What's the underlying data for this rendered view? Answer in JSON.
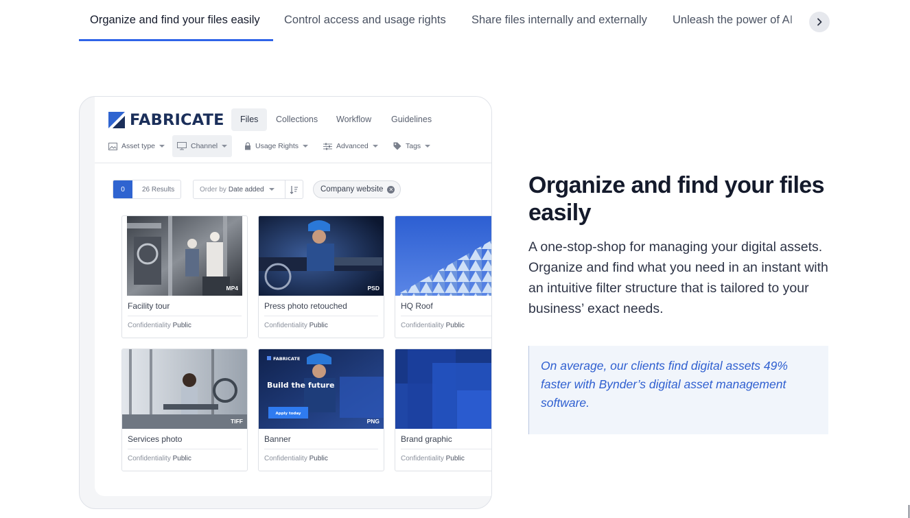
{
  "tabs": {
    "items": [
      {
        "label": "Organize and find your files easily",
        "active": true
      },
      {
        "label": "Control access and usage rights",
        "active": false
      },
      {
        "label": "Share files internally and externally",
        "active": false
      },
      {
        "label": "Unleash the power of AI",
        "active": false
      }
    ],
    "next_icon": "chevron-right-icon",
    "accent_color": "#2f64e8"
  },
  "mock": {
    "logo_text": "FABRICATE",
    "nav": [
      "Files",
      "Collections",
      "Workflow",
      "Guidelines"
    ],
    "filters": [
      {
        "label": "Asset type",
        "icon": "image-icon"
      },
      {
        "label": "Channel",
        "icon": "monitor-icon"
      },
      {
        "label": "Usage Rights",
        "icon": "lock-icon"
      },
      {
        "label": "Advanced",
        "icon": "sliders-icon"
      },
      {
        "label": "Tags",
        "icon": "tag-icon"
      }
    ],
    "selected_count": "0",
    "results_label": "26 Results",
    "order_prefix": "Order by",
    "order_value": "Date added",
    "active_chip": "Company website",
    "meta_label": "Confidentiality",
    "meta_value": "Public",
    "cards": [
      {
        "title": "Facility tour",
        "format": "MP4"
      },
      {
        "title": "Press photo retouched",
        "format": "PSD"
      },
      {
        "title": "HQ Roof",
        "format": ""
      },
      {
        "title": "Services photo",
        "format": "TIFF"
      },
      {
        "title": "Banner",
        "format": "PNG",
        "banner_brand": "FABRICATE",
        "banner_headline": "Build the future",
        "banner_cta": "Apply today"
      },
      {
        "title": "Brand graphic",
        "format": ""
      }
    ]
  },
  "content": {
    "headline": "Organize and find your files easily",
    "body": "A one-stop-shop for managing your digital assets. Organize and find what you need in an instant with an intuitive filter structure that is tailored to your business’ exact needs.",
    "quote": "On average, our clients find digital assets 49% faster with Bynder’s digital asset management software.",
    "quote_color": "#2f5fd0"
  }
}
